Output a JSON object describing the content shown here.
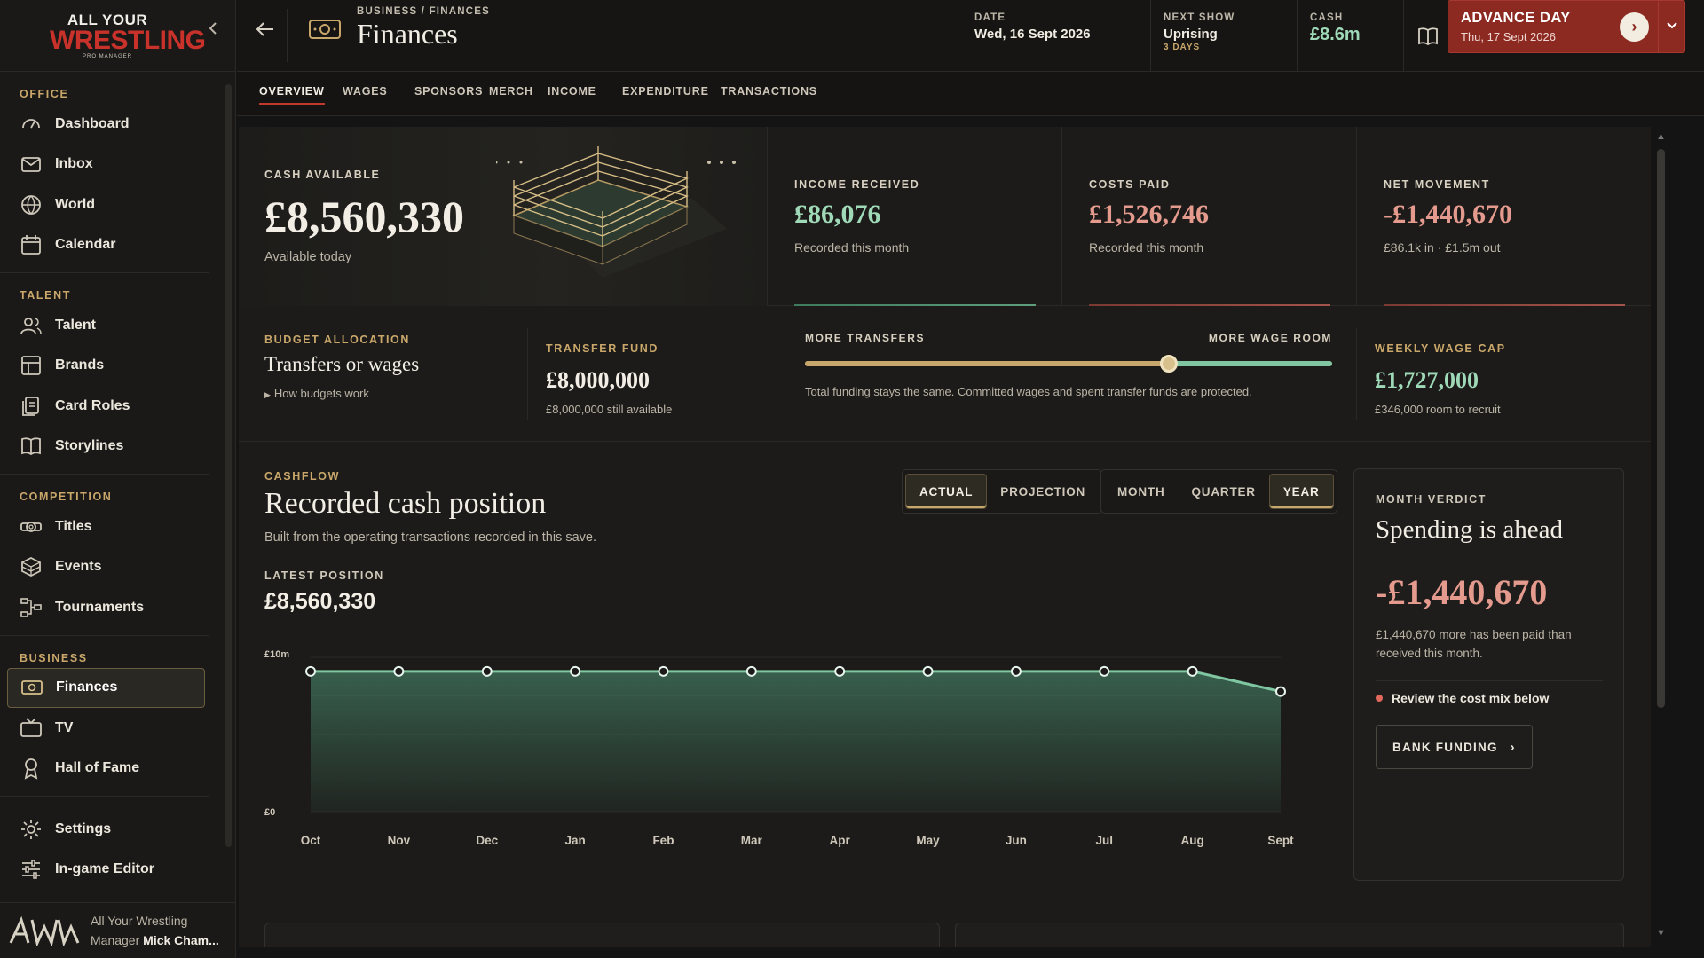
{
  "app": {
    "logo": {
      "line1": "ALL YOUR",
      "line2": "WRESTLING",
      "line3": "PRO MANAGER"
    },
    "footer": {
      "name": "All Your Wrestling",
      "manager_label": "Manager",
      "manager_name": "Mick Cham..."
    }
  },
  "sidebar": {
    "sections": [
      {
        "title": "OFFICE",
        "items": [
          {
            "label": "Dashboard",
            "icon": "gauge-icon"
          },
          {
            "label": "Inbox",
            "icon": "envelope-icon"
          },
          {
            "label": "World",
            "icon": "globe-icon"
          },
          {
            "label": "Calendar",
            "icon": "calendar-icon"
          }
        ]
      },
      {
        "title": "TALENT",
        "items": [
          {
            "label": "Talent",
            "icon": "people-icon"
          },
          {
            "label": "Brands",
            "icon": "layout-icon"
          },
          {
            "label": "Card Roles",
            "icon": "cards-icon"
          },
          {
            "label": "Storylines",
            "icon": "book-icon"
          }
        ]
      },
      {
        "title": "COMPETITION",
        "items": [
          {
            "label": "Titles",
            "icon": "belt-icon"
          },
          {
            "label": "Events",
            "icon": "ring-icon"
          },
          {
            "label": "Tournaments",
            "icon": "bracket-icon"
          }
        ]
      },
      {
        "title": "BUSINESS",
        "items": [
          {
            "label": "Finances",
            "icon": "cash-icon",
            "active": true
          },
          {
            "label": "TV",
            "icon": "tv-icon"
          },
          {
            "label": "Hall of Fame",
            "icon": "award-icon"
          }
        ]
      },
      {
        "title": "",
        "items": [
          {
            "label": "Settings",
            "icon": "gear-icon"
          },
          {
            "label": "In-game Editor",
            "icon": "sliders-icon"
          }
        ]
      }
    ]
  },
  "topbar": {
    "breadcrumb": "BUSINESS / FINANCES",
    "title": "Finances",
    "date_label": "DATE",
    "date_value": "Wed, 16 Sept 2026",
    "show_label": "NEXT SHOW",
    "show_value": "Uprising",
    "show_sub": "3 DAYS",
    "cash_label": "CASH",
    "cash_value": "£8.6m",
    "advance_label": "ADVANCE DAY",
    "advance_date": "Thu, 17 Sept 2026"
  },
  "tabs": [
    "OVERVIEW",
    "WAGES",
    "SPONSORS",
    "MERCH",
    "INCOME",
    "EXPENDITURE",
    "TRANSACTIONS"
  ],
  "active_tab": "OVERVIEW",
  "summary": {
    "cash_label": "CASH AVAILABLE",
    "cash_value": "£8,560,330",
    "cash_sub": "Available today",
    "income_label": "INCOME RECEIVED",
    "income_value": "£86,076",
    "income_sub": "Recorded this month",
    "costs_label": "COSTS PAID",
    "costs_value": "£1,526,746",
    "costs_sub": "Recorded this month",
    "net_label": "NET MOVEMENT",
    "net_value": "-£1,440,670",
    "net_sub": "£86.1k in · £1.5m out"
  },
  "budget": {
    "label": "BUDGET ALLOCATION",
    "title": "Transfers or wages",
    "link": "How budgets work",
    "transfer_label": "TRANSFER FUND",
    "transfer_value": "£8,000,000",
    "transfer_sub": "£8,000,000 still available",
    "slider_left": "MORE TRANSFERS",
    "slider_right": "MORE WAGE ROOM",
    "slider_position": 0.69,
    "slider_note": "Total funding stays the same. Committed wages and spent transfer funds are protected.",
    "cap_label": "WEEKLY WAGE CAP",
    "cap_value": "£1,727,000",
    "cap_sub": "£346,000 room to recruit"
  },
  "cashflow": {
    "label": "CASHFLOW",
    "title": "Recorded cash position",
    "subtitle": "Built from the operating transactions recorded in this save.",
    "latest_label": "LATEST POSITION",
    "latest_value": "£8,560,330",
    "modes": [
      "ACTUAL",
      "PROJECTION"
    ],
    "active_mode": "ACTUAL",
    "periods": [
      "MONTH",
      "QUARTER",
      "YEAR"
    ],
    "active_period": "YEAR"
  },
  "chart_data": {
    "type": "area",
    "x": [
      "Oct",
      "Nov",
      "Dec",
      "Jan",
      "Feb",
      "Mar",
      "Apr",
      "May",
      "Jun",
      "Jul",
      "Aug",
      "Sept"
    ],
    "series": [
      {
        "values": [
          10000000,
          10000000,
          10000000,
          10000000,
          10000000,
          10000000,
          10000000,
          10000000,
          10000000,
          10000000,
          10000000,
          8560330
        ]
      }
    ],
    "ylim": [
      0,
      11000000
    ],
    "y_tick_labels": [
      {
        "value": 11000000,
        "label": "£10m"
      },
      {
        "value": 0,
        "label": "£0"
      }
    ],
    "colors": {
      "line": "#7fc6a1",
      "fill": "#3d6b56"
    }
  },
  "verdict": {
    "label": "MONTH VERDICT",
    "title": "Spending is ahead",
    "value": "-£1,440,670",
    "desc": "£1,440,670 more has been paid than received this month.",
    "note": "Review the cost mix below",
    "button": "BANK FUNDING"
  },
  "colors": {
    "accent_gold": "#c9a76a",
    "positive": "#9fd9b8",
    "negative": "#e59a8e",
    "brand_red": "#8c2a22"
  }
}
